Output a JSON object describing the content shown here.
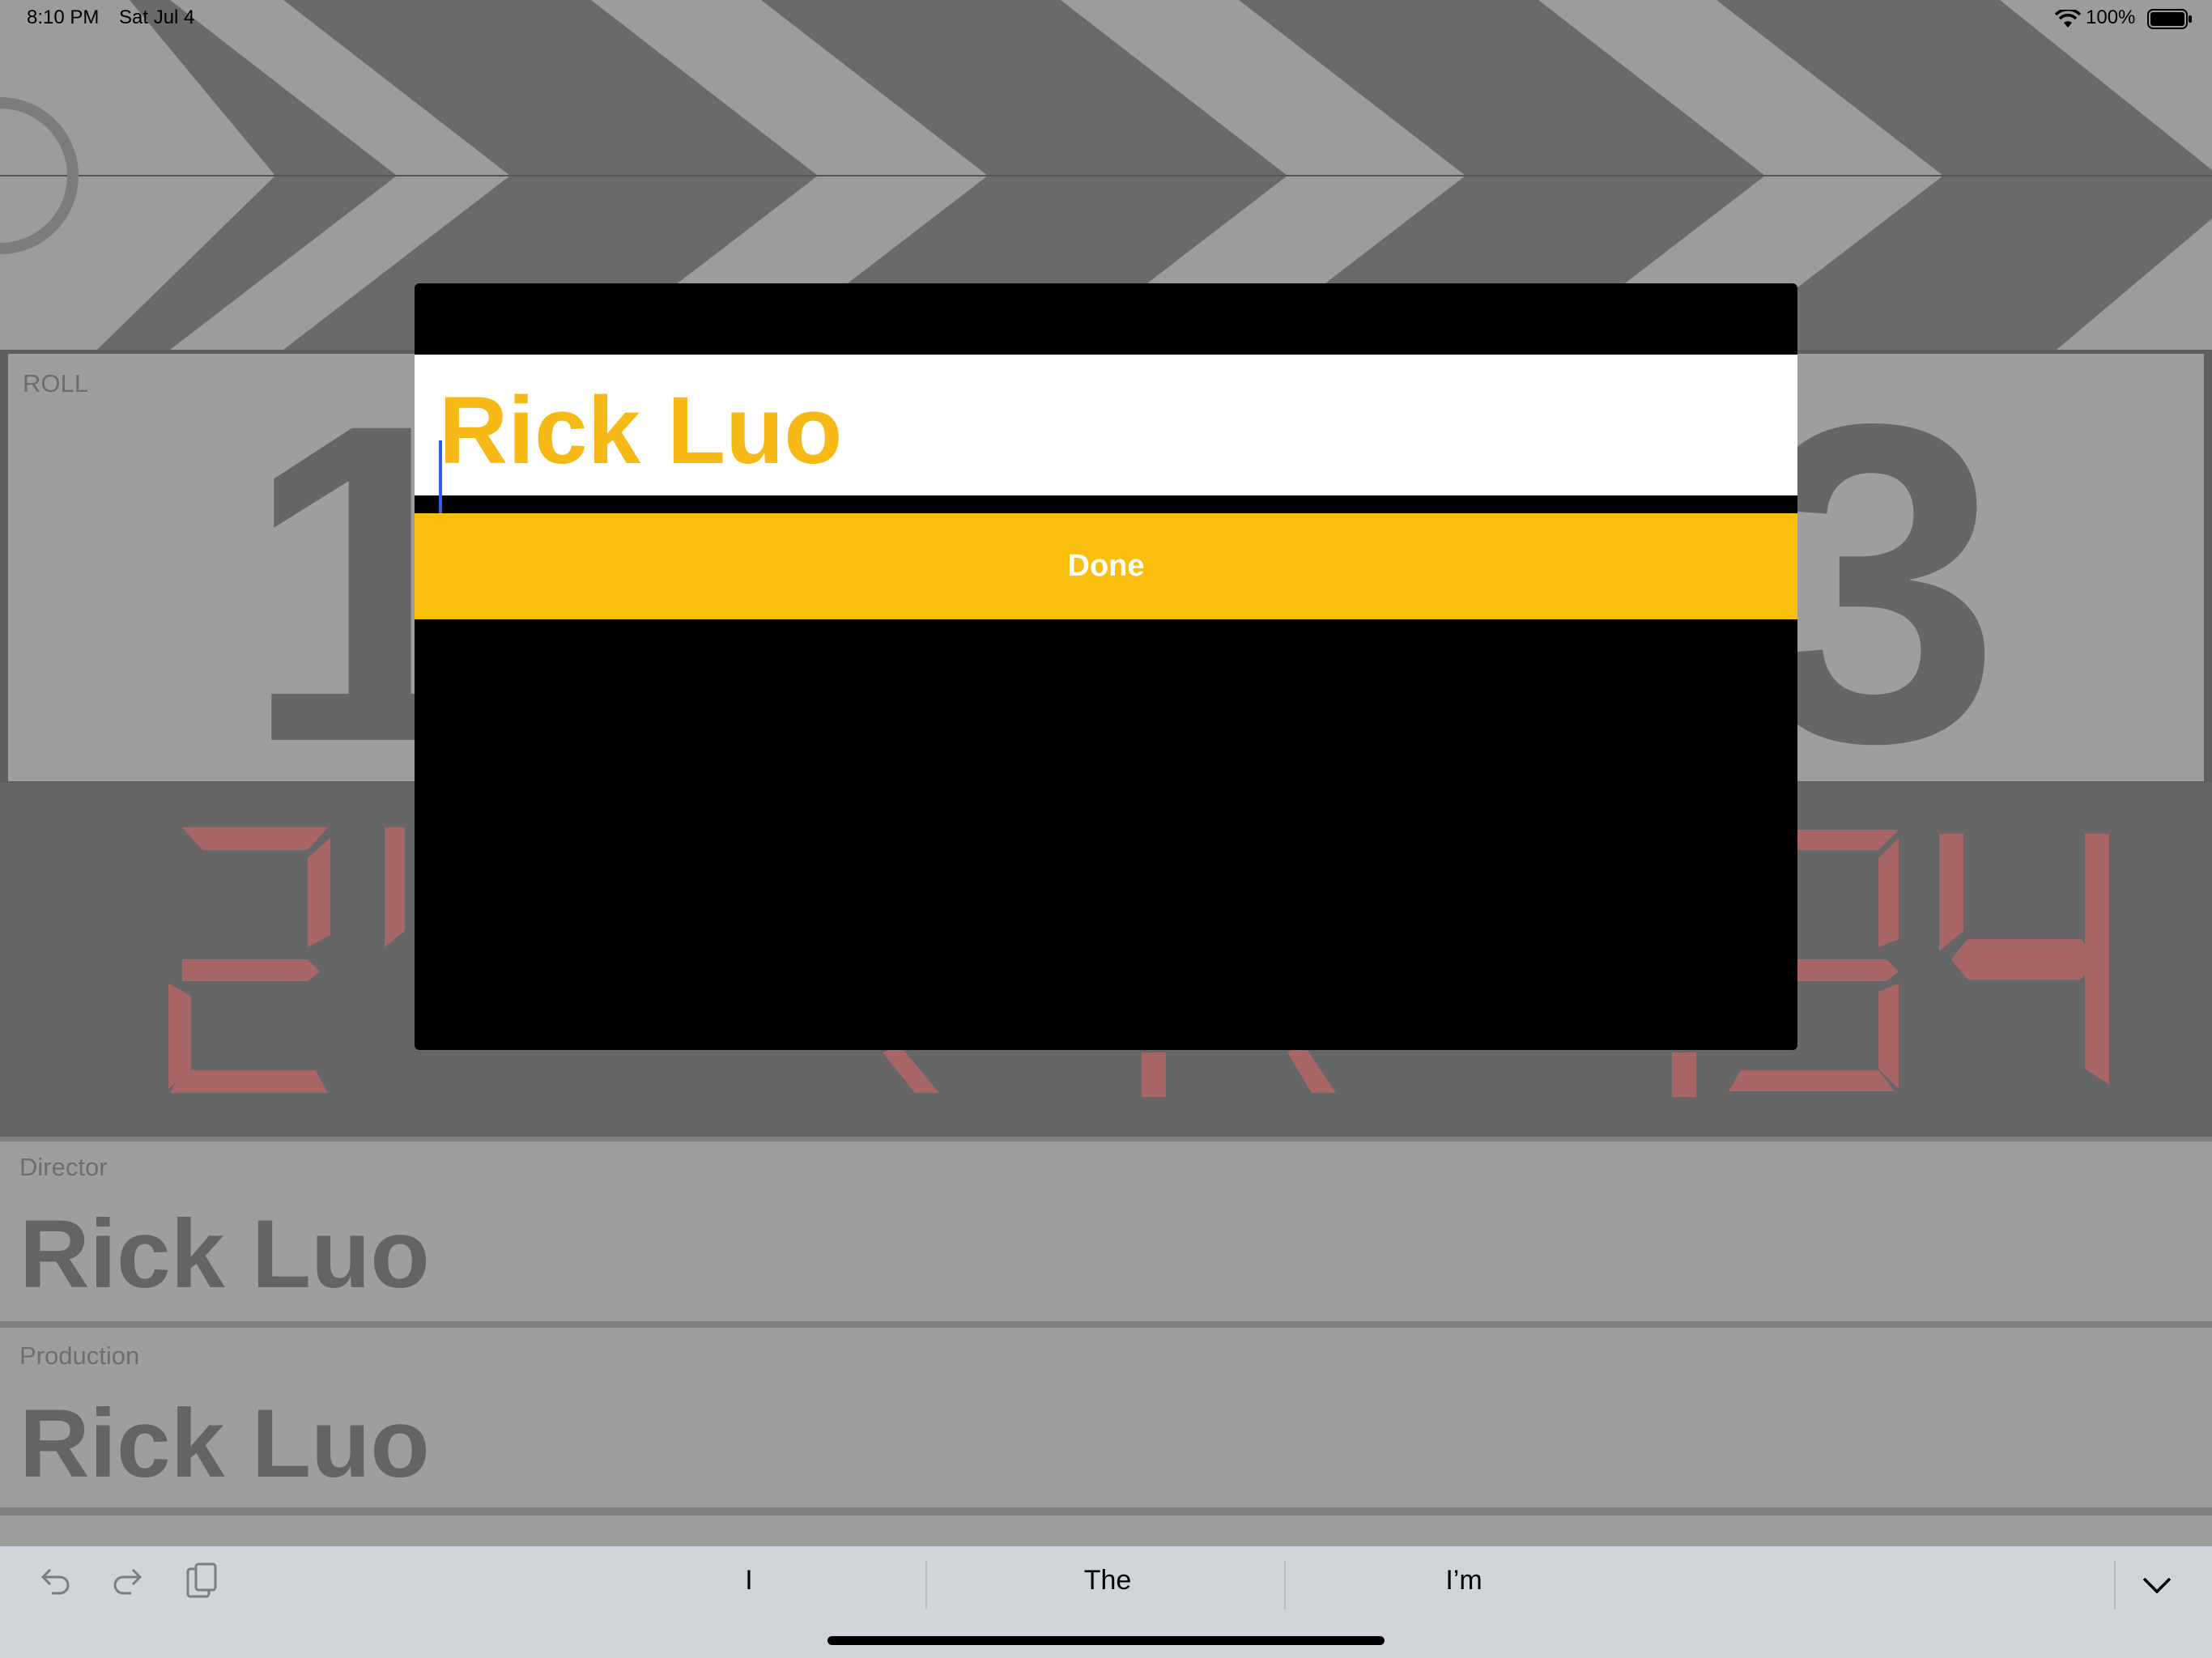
{
  "status_bar": {
    "time": "8:10 PM",
    "date": "Sat Jul 4",
    "battery": "100%"
  },
  "clapper": {
    "roll_label": "ROLL",
    "roll_digit_left": "1",
    "roll_digit_right": "3",
    "director_label": "Director",
    "director_value": "Rick Luo",
    "production_label": "Production",
    "production_value": "Rick Luo",
    "timecode_color": "#a86666"
  },
  "modal": {
    "input_value": "Rick Luo",
    "done_label": "Done",
    "accent": "#f9be0e"
  },
  "keyboard_bar": {
    "suggestions": [
      "I",
      "The",
      "I’m"
    ]
  }
}
